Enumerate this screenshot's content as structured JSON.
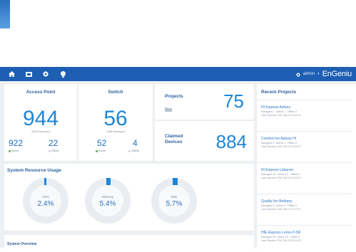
{
  "nav": {
    "icons": [
      "home-icon",
      "dashboard-icon",
      "settings-icon",
      "bulb-icon"
    ],
    "user": "admin",
    "brand": "EnGeniu"
  },
  "access_point": {
    "title": "Access Point",
    "total": "944",
    "total_label": "Total Managed",
    "active": "922",
    "active_label": "Active",
    "offline": "22",
    "offline_label": "Offline"
  },
  "switch": {
    "title": "Switch",
    "total": "56",
    "total_label": "Total Managed",
    "active": "52",
    "active_label": "Active",
    "offline": "4",
    "offline_label": "Offline"
  },
  "projects": {
    "title": "Projects",
    "value": "75"
  },
  "claimed": {
    "title_line1": "Claimed",
    "title_line2": "Devices",
    "value": "884"
  },
  "system": {
    "title": "System Resource Usage",
    "cpu": {
      "name": "CPU",
      "value": "2.4%",
      "fraction": 0.024
    },
    "memory": {
      "name": "Memory",
      "value": "5.4%",
      "fraction": 0.054
    },
    "disk": {
      "name": "Disk",
      "value": "5.7%",
      "fraction": 0.057
    }
  },
  "bottom": {
    "title": "System Overview"
  },
  "recent": {
    "title": "Recent Projects",
    "items": [
      {
        "name": "HI Express Asbury",
        "meta1": "Managed 2 · Active 2 · Offline 0",
        "meta2": "Last Opened: 2017-08-13 15:42:11"
      },
      {
        "name": "Comfort Inn Asbury HI",
        "meta1": "Managed 4 · Active 4 · Offline 0",
        "meta2": "Last Opened: 2017-08-13 13:51:17"
      },
      {
        "name": "HI Express Lebanon",
        "meta1": "Managed 16 · Active 16 · Offline 0",
        "meta2": "Last Opened: 2017-08-13 12:22:07"
      },
      {
        "name": "Quality Inn Bethany",
        "meta1": "Managed 5 · Active 5 · Offline 0",
        "meta2": "Last Opened: 2017-08-13 11:17:07"
      },
      {
        "name": "HIE Express Lenox P-NF",
        "meta1": "Managed 20 · Active 20 · Offline 0",
        "meta2": "Last Opened: 2017-08-13 10:33:23"
      }
    ]
  },
  "colors": {
    "nav": "#1e5fb3",
    "accent": "#1d86d6",
    "active": "#59b25a",
    "offline": "#c9cfd6"
  }
}
